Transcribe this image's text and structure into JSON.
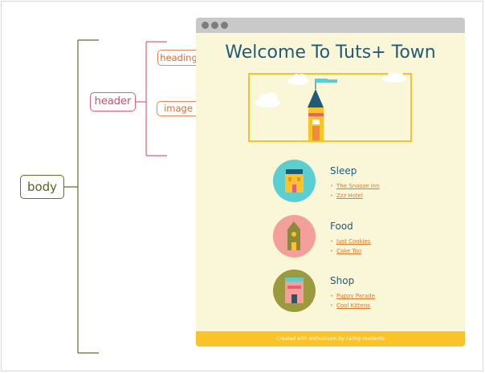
{
  "labels": {
    "body": "body",
    "header": "header",
    "heading": "heading",
    "image": "image"
  },
  "page": {
    "heading": "Welcome To Tuts+ Town",
    "sections": [
      {
        "title": "Sleep",
        "links": [
          "The Snooze Inn",
          "Zzz Hotel"
        ],
        "color": "#5bcfcf"
      },
      {
        "title": "Food",
        "links": [
          "Just Cookies",
          "Cake Too"
        ],
        "color": "#f4a09a"
      },
      {
        "title": "Shop",
        "links": [
          "Puppy Parade",
          "Cool Kittens"
        ],
        "color": "#9c9a3f"
      }
    ],
    "footer": "Created with enthusiasm by caring residents"
  },
  "colors": {
    "body_bracket": "#6b6b2a",
    "header_bracket": "#e2607a",
    "child_bracket": "#e8875a",
    "page_background": "#faf7d9",
    "heading_text": "#1f5a78",
    "accent_yellow": "#fbc32a"
  }
}
